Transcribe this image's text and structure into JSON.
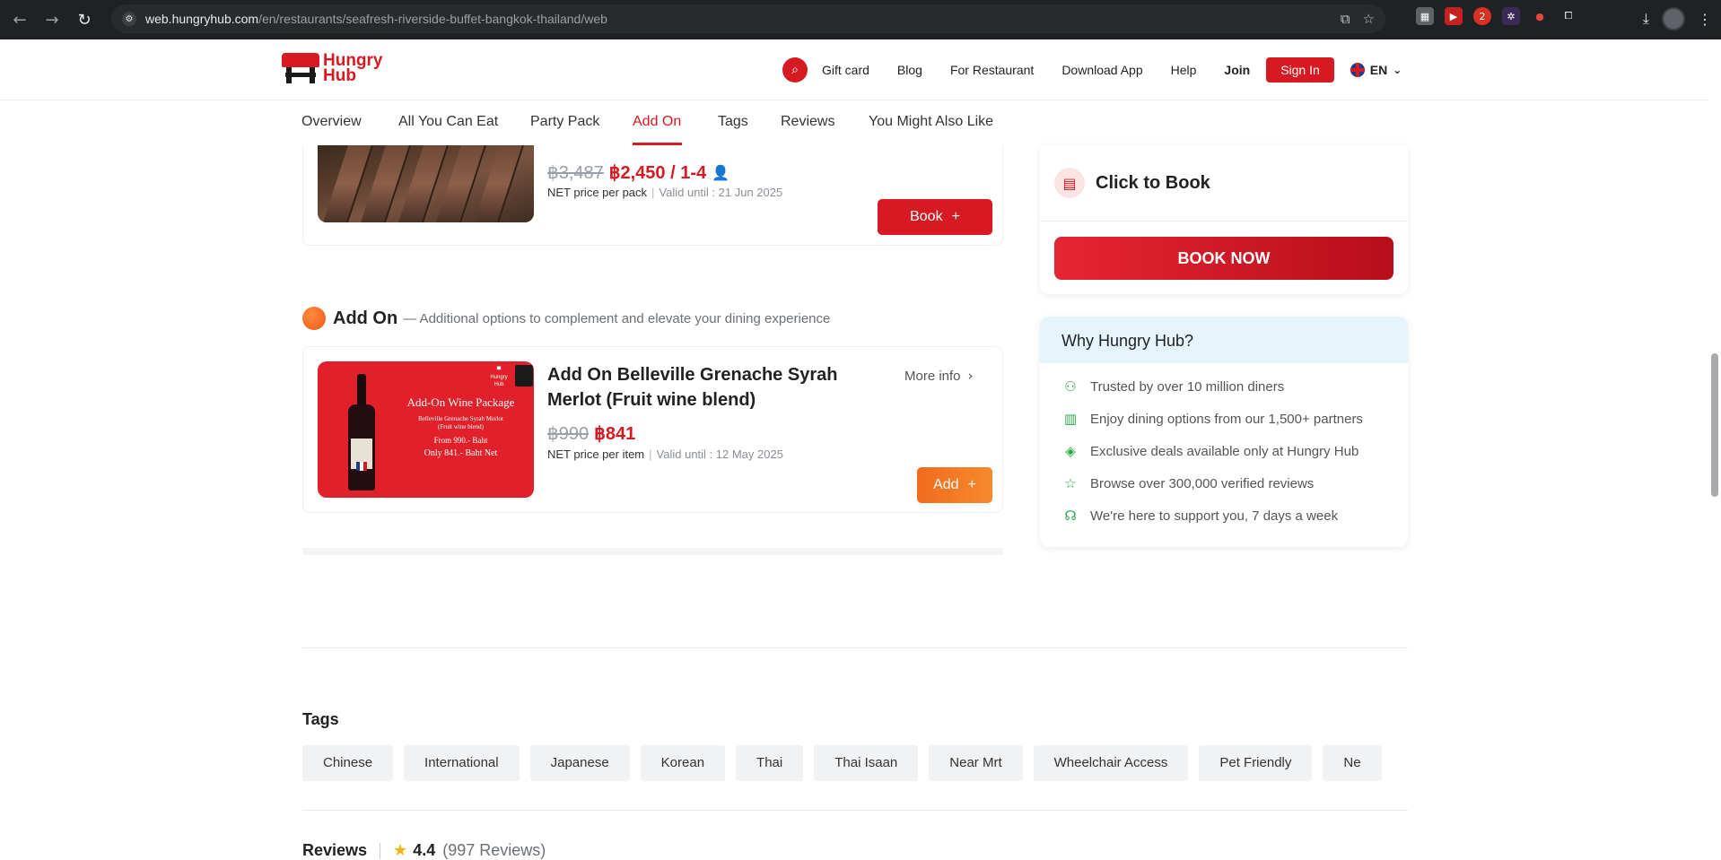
{
  "browser": {
    "url_host": "web.hungryhub.com",
    "url_path": "/en/restaurants/seafresh-riverside-buffet-bangkok-thailand/web",
    "extension_badge": "2"
  },
  "header": {
    "logo_line1": "Hungry",
    "logo_line2": "Hub",
    "links": [
      "Gift card",
      "Blog",
      "For Restaurant",
      "Download App",
      "Help"
    ],
    "join": "Join",
    "sign_in": "Sign In",
    "lang": "EN"
  },
  "tabs": [
    "Overview",
    "All You Can Eat",
    "Party Pack",
    "Add On",
    "Tags",
    "Reviews",
    "You Might Also Like"
  ],
  "active_tab": "Add On",
  "party_pack_item": {
    "old_price": "฿3,487",
    "price": "฿2,450 / 1-4",
    "price_note": "NET price per pack",
    "valid": "Valid until : 21 Jun 2025",
    "book_label": "Book"
  },
  "add_on_section": {
    "title": "Add On",
    "subtitle": "— Additional options to complement and elevate your dining experience",
    "item": {
      "title": "Add On Belleville Grenache Syrah Merlot (Fruit wine blend)",
      "more_info": "More info",
      "old_price": "฿990",
      "price": "฿841",
      "price_note": "NET price per item",
      "valid": "Valid until : 12 May 2025",
      "add_label": "Add",
      "image_text": {
        "t1": "Add-On Wine Package",
        "t2a": "Belleville Grenache Syrah Merlot",
        "t2b": "(Fruit wine blend)",
        "t3": "From 990.- Baht",
        "t4": "Only 841.- Baht Net"
      }
    }
  },
  "booking": {
    "click_to_book": "Click to Book",
    "book_now": "BOOK NOW"
  },
  "why": {
    "title": "Why Hungry Hub?",
    "items": [
      {
        "icon": "user-icon",
        "text": "Trusted by over 10 million diners"
      },
      {
        "icon": "store-icon",
        "text": "Enjoy dining options from our 1,500+ partners"
      },
      {
        "icon": "diamond-icon",
        "text": "Exclusive deals available only at Hungry Hub"
      },
      {
        "icon": "star-icon",
        "text": "Browse over 300,000 verified reviews"
      },
      {
        "icon": "headset-icon",
        "text": "We're here to support you, 7 days a week"
      }
    ]
  },
  "tags_section": {
    "title": "Tags",
    "tags": [
      "Chinese",
      "International",
      "Japanese",
      "Korean",
      "Thai",
      "Thai Isaan",
      "Near Mrt",
      "Wheelchair Access",
      "Pet Friendly",
      "Ne"
    ]
  },
  "reviews": {
    "label": "Reviews",
    "score": "4.4",
    "count": "(997 Reviews)"
  },
  "colors": {
    "brand_red": "#d71921",
    "addon_orange": "#f26b1d",
    "check_green": "#2ba84a"
  }
}
